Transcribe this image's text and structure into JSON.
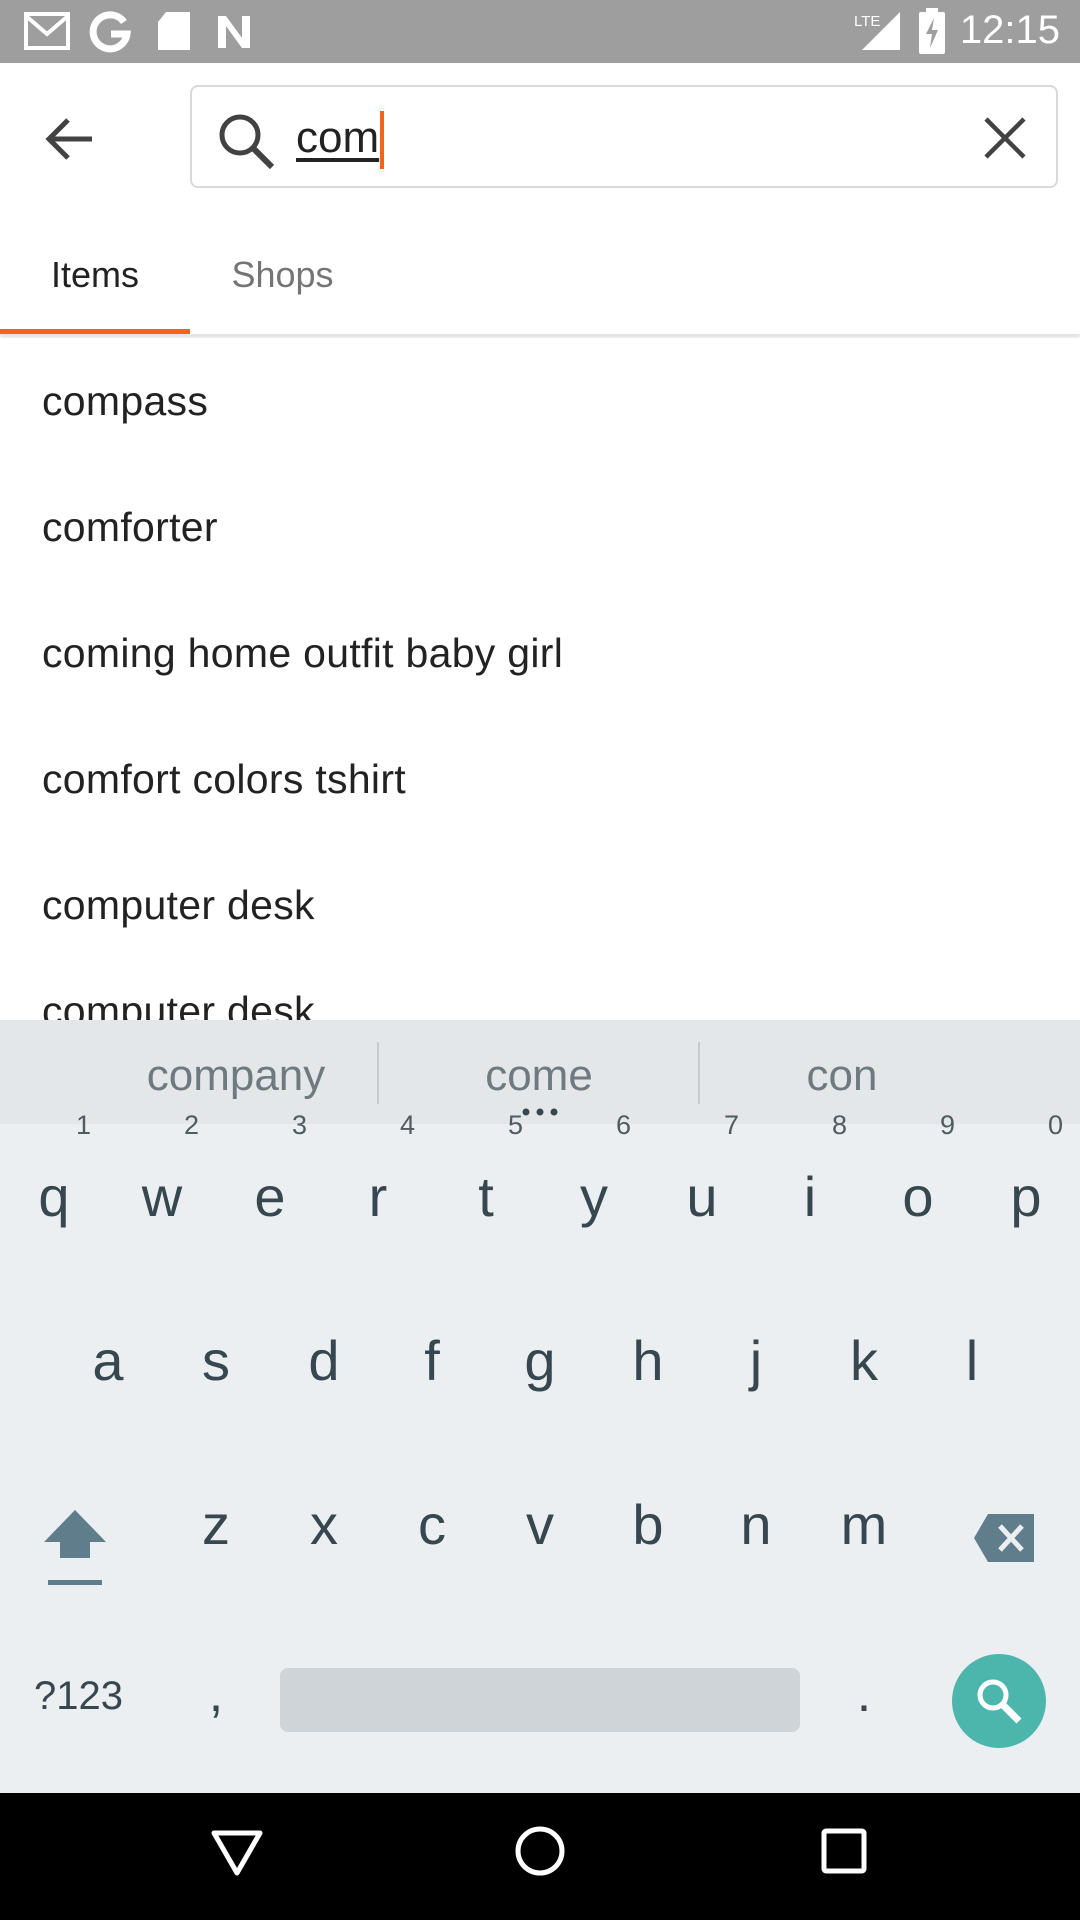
{
  "status_bar": {
    "time": "12:15",
    "network": "LTE",
    "icons": [
      "gmail-icon",
      "google-icon",
      "sd-card-icon",
      "n-icon",
      "lte-signal-icon",
      "battery-charging-icon"
    ]
  },
  "search": {
    "query": "com",
    "back_icon": "arrow-left-icon",
    "search_icon": "magnifier-icon",
    "clear_icon": "close-icon"
  },
  "tabs": [
    {
      "label": "Items",
      "active": true
    },
    {
      "label": "Shops",
      "active": false
    }
  ],
  "colors": {
    "accent": "#f1641e",
    "keyboard_bg": "#eceff1",
    "search_key": "#4db6ac"
  },
  "suggestions": [
    "compass",
    "comforter",
    "coming home outfit baby girl",
    "comfort colors tshirt",
    "computer desk",
    "computer desk"
  ],
  "keyboard": {
    "strip": [
      "company",
      "come",
      "con"
    ],
    "row1": [
      "q",
      "w",
      "e",
      "r",
      "t",
      "y",
      "u",
      "i",
      "o",
      "p"
    ],
    "row1_nums": [
      "1",
      "2",
      "3",
      "4",
      "5",
      "6",
      "7",
      "8",
      "9",
      "0"
    ],
    "row2": [
      "a",
      "s",
      "d",
      "f",
      "g",
      "h",
      "j",
      "k",
      "l"
    ],
    "row3": [
      "z",
      "x",
      "c",
      "v",
      "b",
      "n",
      "m"
    ],
    "symbols_key": "?123",
    "comma": ",",
    "period": "."
  }
}
